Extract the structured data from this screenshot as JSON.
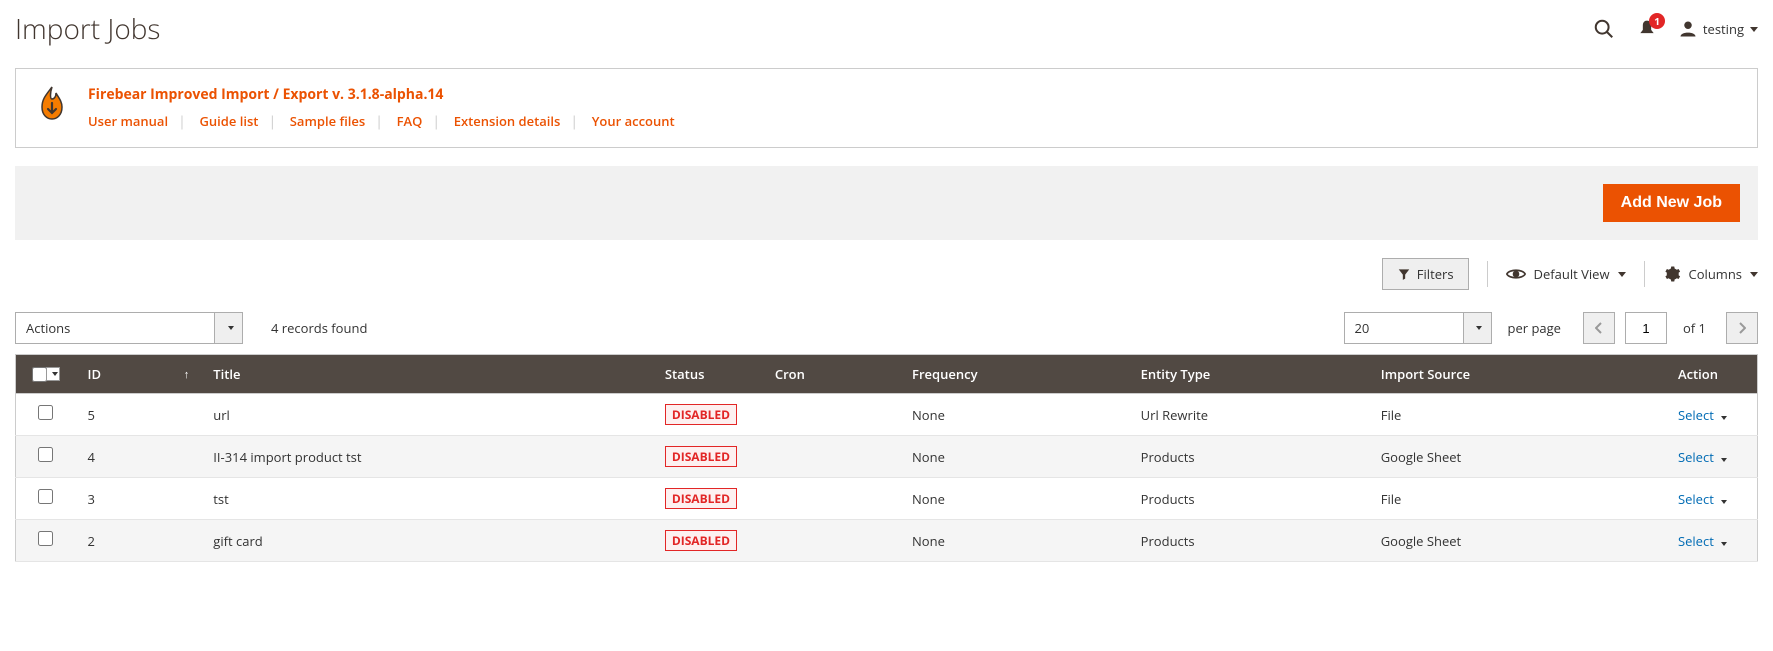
{
  "header": {
    "title": "Import Jobs",
    "notification_count": "1",
    "user_name": "testing"
  },
  "infobox": {
    "title": "Firebear Improved Import / Export v. 3.1.8-alpha.14",
    "links": {
      "user_manual": "User manual",
      "guide_list": "Guide list",
      "sample_files": "Sample files",
      "faq": "FAQ",
      "extension_details": "Extension details",
      "your_account": "Your account"
    }
  },
  "buttons": {
    "add_new_job": "Add New Job",
    "filters": "Filters",
    "default_view": "Default View",
    "columns": "Columns",
    "actions": "Actions",
    "select": "Select"
  },
  "toolbar": {
    "records_found": "4 records found",
    "per_page_value": "20",
    "per_page_label": "per page",
    "page_current": "1",
    "page_of": "of 1"
  },
  "columns": {
    "id": "ID",
    "title": "Title",
    "status": "Status",
    "cron": "Cron",
    "frequency": "Frequency",
    "entity_type": "Entity Type",
    "import_source": "Import Source",
    "action": "Action"
  },
  "rows": [
    {
      "id": "5",
      "title": "url",
      "status": "DISABLED",
      "cron": "",
      "frequency": "None",
      "entity_type": "Url Rewrite",
      "import_source": "File"
    },
    {
      "id": "4",
      "title": "II-314 import product tst",
      "status": "DISABLED",
      "cron": "",
      "frequency": "None",
      "entity_type": "Products",
      "import_source": "Google Sheet"
    },
    {
      "id": "3",
      "title": "tst",
      "status": "DISABLED",
      "cron": "",
      "frequency": "None",
      "entity_type": "Products",
      "import_source": "File"
    },
    {
      "id": "2",
      "title": "gift card",
      "status": "DISABLED",
      "cron": "",
      "frequency": "None",
      "entity_type": "Products",
      "import_source": "Google Sheet"
    }
  ]
}
